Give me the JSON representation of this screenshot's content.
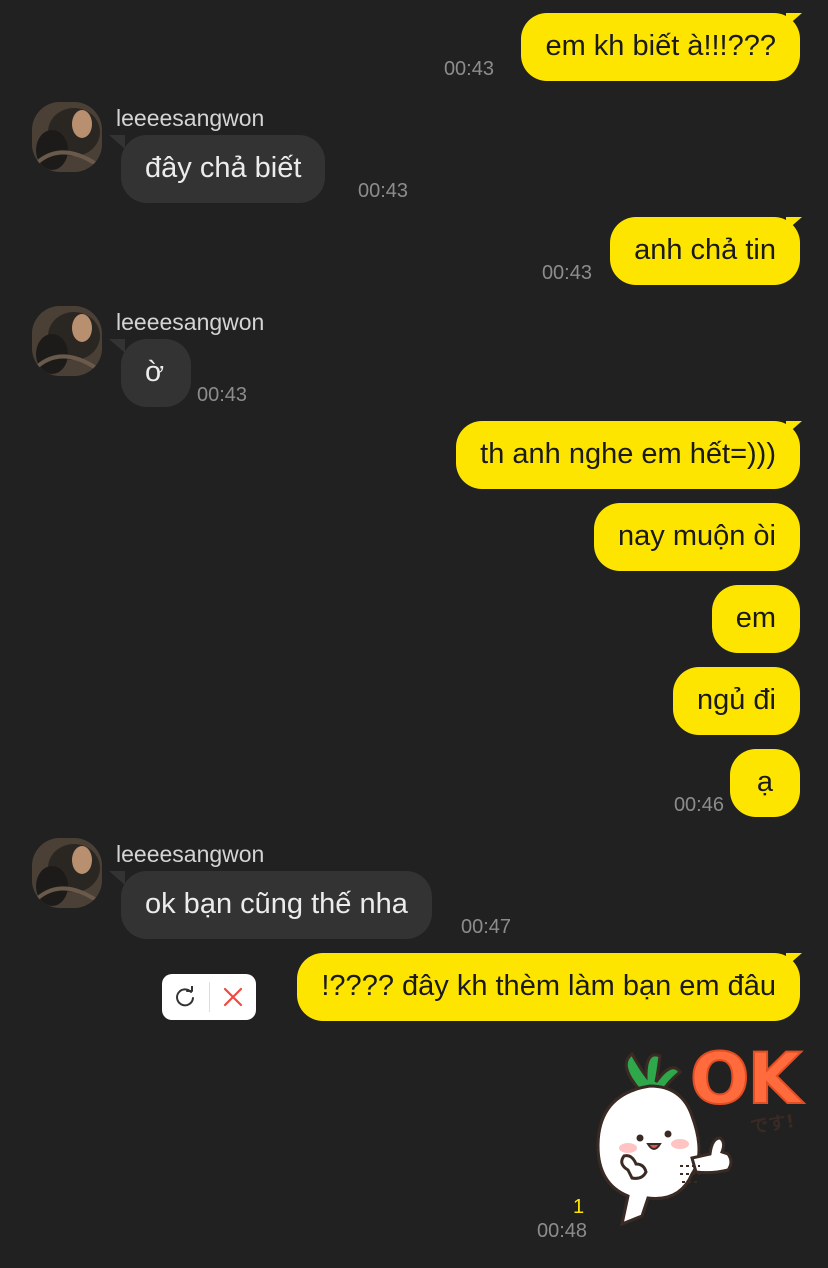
{
  "contact": {
    "name": "leeeesangwon"
  },
  "messages": [
    {
      "side": "out",
      "text": "em kh biết à!!!???",
      "time": "00:43"
    },
    {
      "side": "in",
      "text": "đây chả biết",
      "time": "00:43"
    },
    {
      "side": "out",
      "text": "anh chả tin",
      "time": "00:43"
    },
    {
      "side": "in",
      "text": "ờ",
      "time": "00:43"
    },
    {
      "side": "out",
      "text": "th anh nghe em hết=)))"
    },
    {
      "side": "out",
      "text": "nay muộn òi"
    },
    {
      "side": "out",
      "text": "em"
    },
    {
      "side": "out",
      "text": "ngủ đi"
    },
    {
      "side": "out",
      "text": "ạ",
      "time": "00:46"
    },
    {
      "side": "in",
      "text": "ok bạn cũng thế nha",
      "time": "00:47"
    },
    {
      "side": "out",
      "text": "!???? đây kh thèm làm bạn em đâu",
      "status": "failed"
    }
  ],
  "sticker": {
    "logo_text": "OK",
    "small_text": "です!",
    "unread": "1",
    "time": "00:48"
  },
  "failed_actions": {
    "retry_icon": "retry-icon",
    "delete_icon": "delete-icon"
  },
  "colors": {
    "background": "#212121",
    "outgoing": "#fee500",
    "incoming": "#333333",
    "ok_text": "#ff6b3d"
  }
}
